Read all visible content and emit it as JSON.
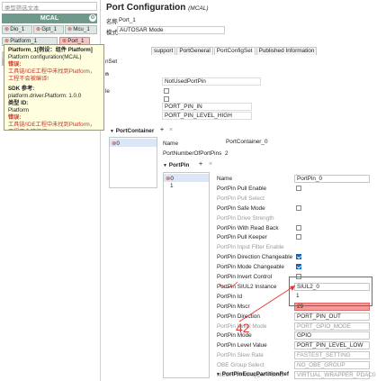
{
  "left": {
    "search_placeholder": "类型筛选文本",
    "section": "MCAL",
    "chips": [
      {
        "prefix": "⊗",
        "label": "Dio_1"
      },
      {
        "prefix": "⊗",
        "label": "Gpt_1"
      },
      {
        "prefix": "⊗",
        "label": "Mcu_1"
      },
      {
        "prefix": "⊗",
        "label": "Platform_1"
      },
      {
        "prefix": "⊗",
        "label": "Port_1"
      }
    ]
  },
  "tooltip": {
    "title": "Platform_1[例设：组件 Platform]",
    "line1": "Platform configuration(MCAL)",
    "err_label1": "错误:",
    "err_text1": "工具链/IDE工程中未找到Platform，工程不会被编译!",
    "sdk_label": "SDK 参考:",
    "sdk_value": "platform.driver.Platform: 1.0.0",
    "type_label": "类型 ID:",
    "type_value": "Platform",
    "err_label2": "错误:",
    "err_text2": "工具链/IDE工程中未找到Platform，工程不会被编译!"
  },
  "header": {
    "title": "Port Configuration",
    "title_suffix": "(MCAL)",
    "name_label": "名称",
    "name_value": "Port_1",
    "mode_label": "模式",
    "mode_value": "AUTOSAR Mode"
  },
  "tabs": [
    "support",
    "PortGeneral",
    "PortConfigSet",
    "Published Information"
  ],
  "partial": {
    "fragment1": "nSet",
    "fragment2": "n",
    "fragment3": "le",
    "not_used_pin": "NotUsedPortPin",
    "pin_in": "PORT_PIN_IN",
    "pin_level_high": "PORT_PIN_LEVEL_HIGH"
  },
  "port_container": {
    "title": "PortContainer",
    "items": [
      "0"
    ],
    "name_label": "Name",
    "name_value": "PortContainer_0",
    "num_label": "PortNumberOfPortPins",
    "num_value": "2"
  },
  "portpin": {
    "title": "PortPin",
    "items": [
      "0",
      "1"
    ]
  },
  "props": [
    {
      "label": "Name",
      "type": "text",
      "value": "PortPin_0",
      "disabled": false
    },
    {
      "label": "PortPin Pull Enable",
      "type": "check",
      "checked": false,
      "disabled": false
    },
    {
      "label": "PortPin Pull Select",
      "type": "none",
      "disabled": true
    },
    {
      "label": "PortPin Safe Mode",
      "type": "check",
      "checked": false,
      "disabled": false
    },
    {
      "label": "PortPin Drive Strength",
      "type": "none",
      "disabled": true
    },
    {
      "label": "PortPin With Read Back",
      "type": "check",
      "checked": false,
      "disabled": false
    },
    {
      "label": "PortPin Pull Keeper",
      "type": "check",
      "checked": false,
      "disabled": false
    },
    {
      "label": "PortPin Input Filter Enable",
      "type": "none",
      "disabled": true
    },
    {
      "label": "PortPin Direction Changeable",
      "type": "check",
      "checked": true,
      "disabled": false
    },
    {
      "label": "PortPin Mode Changeable",
      "type": "check",
      "checked": true,
      "disabled": false
    },
    {
      "label": "PortPin Invert Control",
      "type": "check",
      "checked": false,
      "disabled": false
    },
    {
      "label": "PortPin SIUL2 Instance",
      "type": "text",
      "value": "SIUL2_0",
      "disabled": false
    },
    {
      "label": "PortPin Id",
      "type": "plain",
      "value": "1",
      "disabled": false
    },
    {
      "label": "PortPin Mscr",
      "type": "text",
      "value": "29",
      "disabled": false,
      "highlight": true
    },
    {
      "label": "PortPin Direction",
      "type": "text",
      "value": "PORT_PIN_OUT",
      "disabled": false
    },
    {
      "label": "PortPin Initial Mode",
      "type": "text",
      "value": "PORT_GPIO_MODE",
      "disabled": true
    },
    {
      "label": "PortPin Mode",
      "type": "text",
      "value": "GPIO",
      "disabled": false
    },
    {
      "label": "PortPin Level Value",
      "type": "text",
      "value": "PORT_PIN_LEVEL_LOW",
      "disabled": false
    },
    {
      "label": "PortPin Slew Rate",
      "type": "text",
      "value": "FASTEST_SETTING",
      "disabled": true
    },
    {
      "label": "OBE Group Select",
      "type": "text",
      "value": "NO_OBE_GROUP",
      "disabled": true
    },
    {
      "label": "MSCR VirtWrapper PDAC",
      "type": "text",
      "value": "VIRTUAL_WRAPPER_PDAC0",
      "disabled": true
    },
    {
      "label": "IMCR VirtWrapper PDAC",
      "type": "text",
      "value": "VIRTUAL_WRAPPER_PDAC0",
      "disabled": true
    }
  ],
  "ecuc": {
    "title": "PortPinEcucPartitionRef"
  },
  "annotation": {
    "text": "42",
    "color": "#e53935"
  }
}
